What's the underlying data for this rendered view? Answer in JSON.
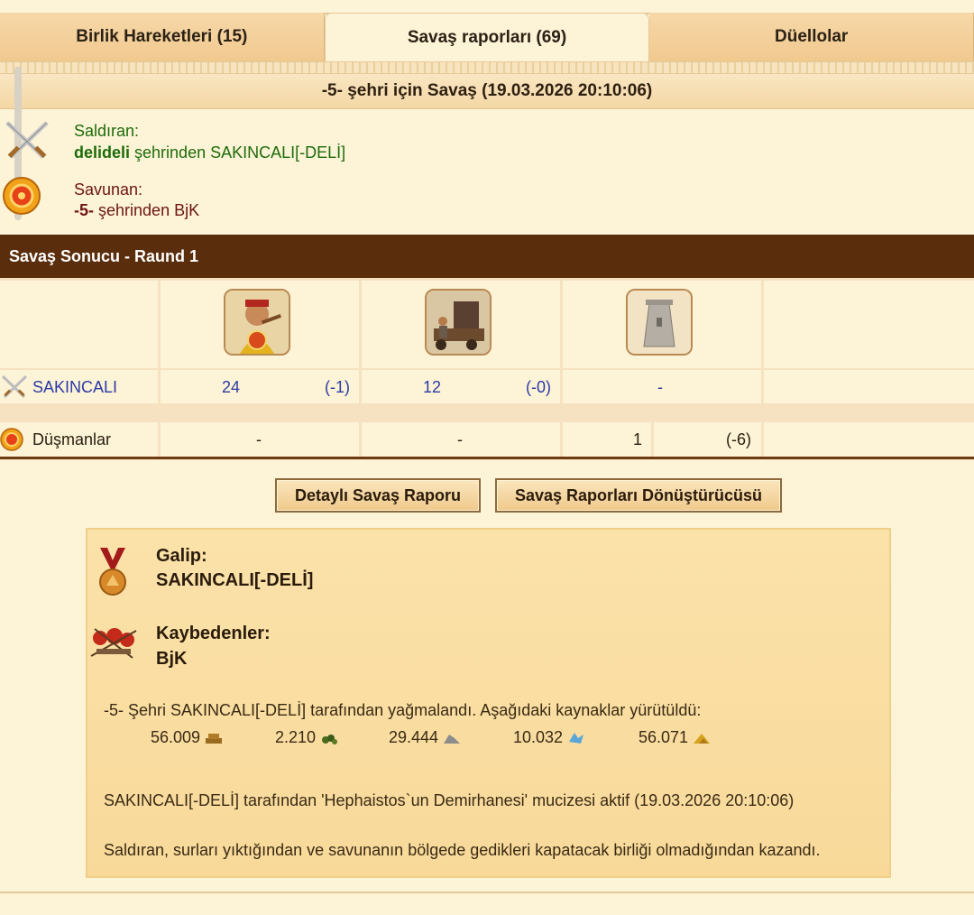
{
  "tabs": [
    {
      "label": "Birlik Hareketleri (15)"
    },
    {
      "label": "Savaş raporları (69)"
    },
    {
      "label": "Düellolar"
    }
  ],
  "battle_title": "-5- şehri için Savaş (19.03.2026 20:10:06)",
  "attacker": {
    "label": "Saldıran:",
    "player": "delideli",
    "from_text": "şehrinden SAKINCALI[-DELİ]"
  },
  "defender": {
    "label": "Savunan:",
    "city": "-5-",
    "from_text": "şehrinden BjK"
  },
  "result_header": "Savaş Sonucu - Raund 1",
  "rows": {
    "own": {
      "name": "SAKINCALI",
      "u1": "24",
      "u1_loss": "(-1)",
      "u2": "12",
      "u2_loss": "(-0)",
      "u3": "-"
    },
    "enemy": {
      "name": "Düşmanlar",
      "u1": "-",
      "u2": "-",
      "u3": "1",
      "u3_loss": "(-6)"
    }
  },
  "buttons": {
    "detailed": "Detaylı Savaş Raporu",
    "converter": "Savaş Raporları Dönüştürücüsü"
  },
  "summary": {
    "winner_label": "Galip:",
    "winner": "SAKINCALI[-DELİ]",
    "losers_label": "Kaybedenler:",
    "loser": "BjK",
    "plunder_text": "-5- Şehri SAKINCALI[-DELİ] tarafından yağmalandı. Aşağıdaki kaynaklar yürütüldü:",
    "resources": [
      {
        "amount": "56.009",
        "icon": "wood-icon",
        "color": "#9a6a1e"
      },
      {
        "amount": "2.210",
        "icon": "wine-icon",
        "color": "#4a6b1e"
      },
      {
        "amount": "29.444",
        "icon": "marble-icon",
        "color": "#8d8d8d"
      },
      {
        "amount": "10.032",
        "icon": "crystal-icon",
        "color": "#5aa6d8"
      },
      {
        "amount": "56.071",
        "icon": "sulfur-icon",
        "color": "#d6a21e"
      }
    ],
    "wonder_text": "SAKINCALI[-DELİ] tarafından 'Hephaistos`un Demirhanesi' mucizesi aktif (19.03.2026 20:10:06)",
    "reason_text": "Saldıran, surları yıktığından ve savunanın bölgede gedikleri kapatacak birliği olmadığından kazandı."
  }
}
